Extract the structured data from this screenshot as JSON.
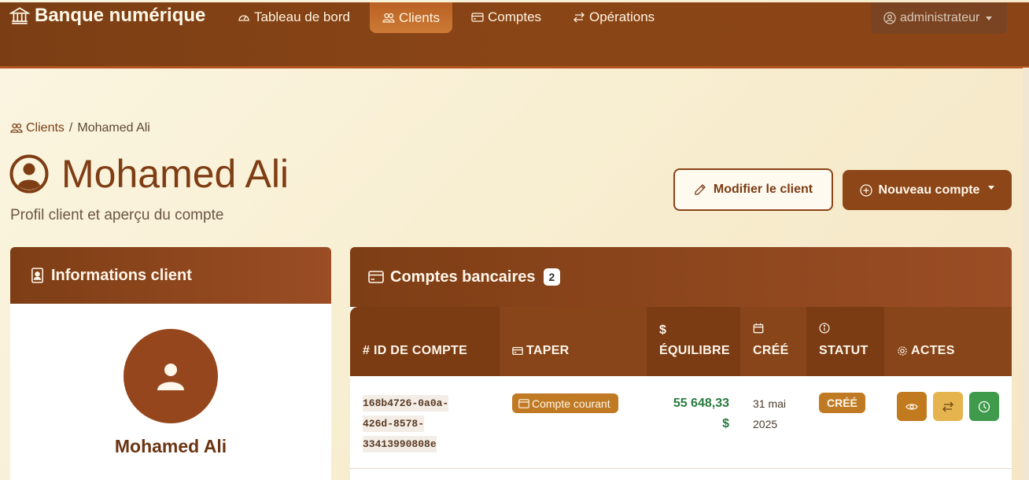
{
  "navbar": {
    "brand": "Banque numérique",
    "items": [
      {
        "label": "Tableau de bord",
        "icon": "gauge-icon"
      },
      {
        "label": "Clients",
        "icon": "people-icon",
        "active": true
      },
      {
        "label": "Comptes",
        "icon": "credit-card-icon"
      },
      {
        "label": "Opérations",
        "icon": "arrows-exchange-icon"
      }
    ],
    "user": "administrateur"
  },
  "breadcrumb": {
    "parent": "Clients",
    "separator": "/",
    "current": "Mohamed Ali"
  },
  "header": {
    "title": "Mohamed Ali",
    "subtitle": "Profil client et aperçu du compte",
    "edit_button": "Modifier le client",
    "new_account_button": "Nouveau compte"
  },
  "client_card": {
    "title": "Informations client",
    "name": "Mohamed Ali"
  },
  "accounts_card": {
    "title": "Comptes bancaires",
    "count": "2",
    "columns": {
      "id": "# ID DE COMPTE",
      "type": "TAPER",
      "balance_symbol": "$",
      "balance": "ÉQUILIBRE",
      "created": "CRÉÉ",
      "status": "STATUT",
      "actions": "ACTES"
    },
    "rows": [
      {
        "id_lines": [
          "168b4726-0a0a-",
          "426d-8578-",
          "33413990808e"
        ],
        "type": "Compte courant",
        "balance_amount": "55 648,33",
        "balance_currency": "$",
        "created_day": "31 mai",
        "created_year": "2025",
        "status": "CRÉÉ"
      }
    ]
  },
  "colors": {
    "brown_primary": "#7b3c14",
    "accent_orange": "#c07a24",
    "balance_green": "#2a7a3e",
    "background": "#fbf6e2"
  }
}
